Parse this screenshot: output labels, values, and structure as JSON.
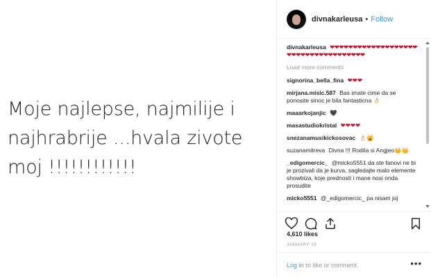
{
  "post": {
    "image_text": "Moje najlepse, najmilije i najhrabrije ...hvala zivote moj !!!!!!!!!!!!"
  },
  "header": {
    "username": "divnakarleusa",
    "dot": "•",
    "follow_label": "Follow"
  },
  "caption": {
    "username": "divnakarleusa",
    "text": "❤❤❤❤❤❤❤❤❤❤❤❤❤❤❤❤❤❤❤❤❤❤❤❤❤❤❤❤❤❤❤❤❤❤❤❤"
  },
  "load_more_label": "Load more comments",
  "comments": [
    {
      "username": "signorina_bella_fina",
      "text": "❤❤❤"
    },
    {
      "username": "mirjana.misic.587",
      "text": "Bas imate cime da se ponosite sinoc je bila fantasticna 👌🏻"
    },
    {
      "username": "maaarkojanjic",
      "text": "🖤"
    },
    {
      "username": "masastudiokristal",
      "text": "❤❤❤❤"
    },
    {
      "username": "snezanamusikickosovac",
      "text": "👌🏻🙀"
    },
    {
      "username": "suzanamitreva",
      "text": "Divna !!! Rodila si Angjeo👑👑"
    },
    {
      "username": "_edigomercic_",
      "text": "@micko5551 da ste fanovi ne bi je prozivali da je kurva, sagledajte malo elemente showbiza, koje prednosti i mane nosi onda prosudite"
    },
    {
      "username": "micko5551",
      "text": "@_edigomercic_ pa nisam joj"
    }
  ],
  "icons": {
    "like": "heart-icon",
    "comment": "comment-icon",
    "share": "share-icon",
    "save": "bookmark-icon",
    "more": "more-icon"
  },
  "likes_text": "4,610 likes",
  "date_text": "JANUARY 29",
  "login": {
    "link": "Log in",
    "rest": "to like or comment.",
    "more": "•••"
  },
  "colors": {
    "link_blue": "#3897f0",
    "heart_red": "#c0132b",
    "muted": "#999999",
    "border": "#efefef"
  }
}
